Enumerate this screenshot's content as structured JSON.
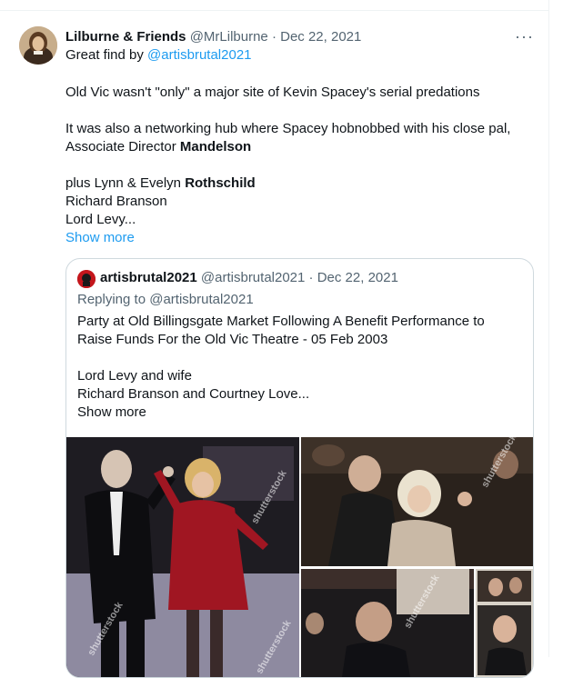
{
  "tweet": {
    "author_name": "Lilburne & Friends",
    "author_handle": "@MrLilburne",
    "separator": "·",
    "date": "Dec 22, 2021",
    "more_label": "···",
    "line1_prefix": "Great find by ",
    "line1_mention": "@artisbrutal2021",
    "line2": "Old Vic wasn't \"only\" a major site of Kevin Spacey's serial predations",
    "line3": "It was also a networking hub where Spacey hobnobbed with his close pal,",
    "line4_prefix": "Associate Director ",
    "line4_bold": "Mandelson",
    "line5_prefix": "plus Lynn & Evelyn ",
    "line5_bold": "Rothschild",
    "line6": "Richard Branson",
    "line7": "Lord Levy...",
    "show_more": "Show more"
  },
  "quoted": {
    "author_name": "artisbrutal2021",
    "author_handle": "@artisbrutal2021",
    "separator": "·",
    "date": "Dec 22, 2021",
    "replying_prefix": "Replying to ",
    "replying_handle": "@artisbrutal2021",
    "line1": "Party at Old Billingsgate Market Following A Benefit Performance to",
    "line2": "Raise Funds For the Old Vic Theatre - 05 Feb 2003",
    "line3": "Lord Levy and wife",
    "line4": "Richard Branson and Courtney Love...",
    "show_more": "Show more",
    "watermark": "shutterstock"
  }
}
